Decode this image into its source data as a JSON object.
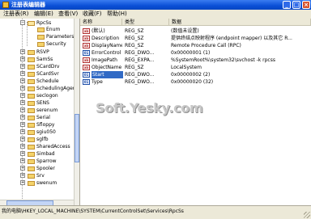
{
  "window": {
    "title": "注册表编辑器"
  },
  "menu": [
    "注册表(R)",
    "编辑(E)",
    "查看(V)",
    "收藏(F)",
    "帮助(H)"
  ],
  "tree": {
    "items": [
      {
        "label": "RpcSs",
        "expander": "−",
        "open": true
      },
      {
        "label": "Enum"
      },
      {
        "label": "Parameters"
      },
      {
        "label": "Security"
      },
      {
        "label": "RSVP",
        "expander": "+"
      },
      {
        "label": "SamSs",
        "expander": "+"
      },
      {
        "label": "SCardDrv",
        "expander": "+"
      },
      {
        "label": "SCardSvr",
        "expander": "+"
      },
      {
        "label": "Schedule",
        "expander": "+"
      },
      {
        "label": "SchedulingAgent",
        "expander": "+"
      },
      {
        "label": "seclogon",
        "expander": "+"
      },
      {
        "label": "SENS",
        "expander": "+"
      },
      {
        "label": "serenum",
        "expander": "+"
      },
      {
        "label": "Serial",
        "expander": "+"
      },
      {
        "label": "Sfloppy",
        "expander": "+"
      },
      {
        "label": "sgiu050",
        "expander": "+"
      },
      {
        "label": "sglfb",
        "expander": "+"
      },
      {
        "label": "SharedAccess",
        "expander": "+"
      },
      {
        "label": "Simbad",
        "expander": "+"
      },
      {
        "label": "Sparrow",
        "expander": "+"
      },
      {
        "label": "Spooler",
        "expander": "+"
      },
      {
        "label": "Srv",
        "expander": "+"
      },
      {
        "label": "swenum",
        "expander": "+"
      }
    ]
  },
  "list": {
    "columns": [
      "名称",
      "类型",
      "数据"
    ],
    "rows": [
      {
        "icon": "string-value-icon",
        "name": "(默认)",
        "type": "REG_SZ",
        "data": "(数值未设置)"
      },
      {
        "icon": "string-value-icon",
        "name": "Description",
        "type": "REG_SZ",
        "data": "提供终结点映射程序 (endpoint mapper) 以及其它 R..."
      },
      {
        "icon": "string-value-icon",
        "name": "DisplayName",
        "type": "REG_SZ",
        "data": "Remote Procedure Call (RPC)"
      },
      {
        "icon": "dword-value-icon",
        "name": "ErrorControl",
        "type": "REG_DWO...",
        "data": "0x00000001 (1)"
      },
      {
        "icon": "string-value-icon",
        "name": "ImagePath",
        "type": "REG_EXPA...",
        "data": "%SystemRoot%\\system32\\svchost -k rpcss"
      },
      {
        "icon": "string-value-icon",
        "name": "ObjectName",
        "type": "REG_SZ",
        "data": "LocalSystem"
      },
      {
        "icon": "dword-value-icon",
        "name": "Start",
        "type": "REG_DWO...",
        "data": "0x00000002 (2)",
        "selected": true
      },
      {
        "icon": "dword-value-icon",
        "name": "Type",
        "type": "REG_DWO...",
        "data": "0x00000020 (32)"
      }
    ]
  },
  "status": {
    "path": "我的电脑\\HKEY_LOCAL_MACHINE\\SYSTEM\\CurrentControlSet\\Services\\RpcSs"
  },
  "watermark": "Soft.Yesky.com",
  "colors": {
    "title_bar": "#0a4fd6",
    "selection": "#316ac5",
    "close_button": "#d8542f"
  }
}
